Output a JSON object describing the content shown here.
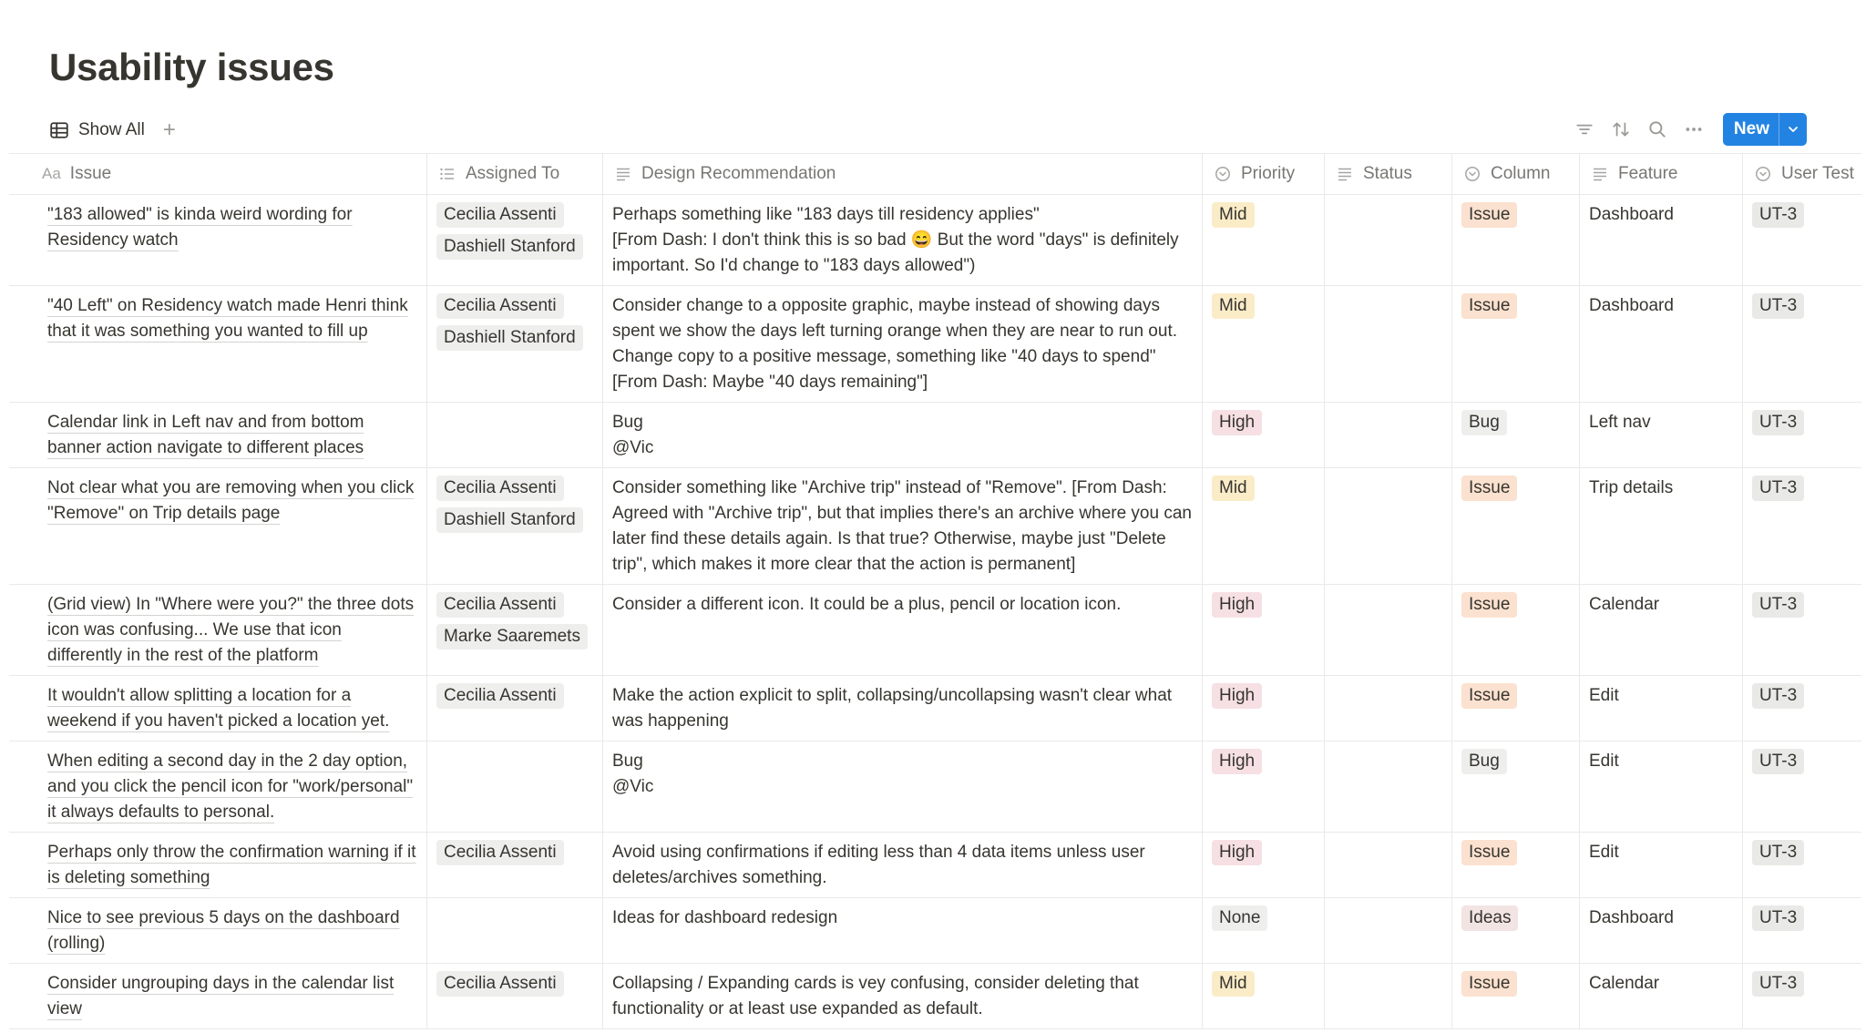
{
  "page": {
    "title": "Usability issues"
  },
  "view": {
    "label": "Show All",
    "add_symbol": "+"
  },
  "toolbar": {
    "new_label": "New"
  },
  "columns": [
    "Issue",
    "Assigned To",
    "Design Recommendation",
    "Priority",
    "Status",
    "Column",
    "Feature",
    "User Test"
  ],
  "column_icons": [
    "text-type-icon",
    "list-icon",
    "lines-icon",
    "select-icon",
    "lines-icon",
    "select-icon",
    "lines-icon",
    "select-icon"
  ],
  "tag_colors": {
    "Mid": "#fbecc8",
    "High": "#f6e0e4",
    "None": "#eeeeec",
    "Issue": "#fbe1cf",
    "Bug": "#eeeeec",
    "Ideas": "#f3e4e4",
    "UT-3": "#e9e9e7"
  },
  "rows": [
    {
      "issue": "\"183 allowed\" is kinda weird wording for Residency watch",
      "assigned": [
        "Cecilia Assenti",
        "Dashiell Stanford"
      ],
      "recommendation": [
        "Perhaps something like \"183 days till residency applies\"",
        "[From Dash: I don't think this is so bad 😄 But the word \"days\" is definitely important. So I'd change to \"183 days allowed\")"
      ],
      "priority": "Mid",
      "status": "",
      "column": "Issue",
      "feature": "Dashboard",
      "user_test": "UT-3"
    },
    {
      "issue": "\"40 Left\" on Residency watch made Henri think that it was something you wanted to fill up",
      "assigned": [
        "Cecilia Assenti",
        "Dashiell Stanford"
      ],
      "recommendation": [
        "Consider change to a opposite graphic, maybe instead of showing days spent we show the days left turning orange when they are near to run out. Change copy to a positive message, something like \"40 days to spend\"",
        "[From Dash: Maybe \"40 days remaining\"]"
      ],
      "priority": "Mid",
      "status": "",
      "column": "Issue",
      "feature": "Dashboard",
      "user_test": "UT-3"
    },
    {
      "issue": "Calendar link in Left nav and from bottom banner action navigate to different places",
      "assigned": [],
      "recommendation": [
        "Bug",
        "@Vic"
      ],
      "priority": "High",
      "status": "",
      "column": "Bug",
      "feature": "Left nav",
      "user_test": "UT-3"
    },
    {
      "issue": "Not clear what you are removing when you click \"Remove\" on Trip details page",
      "assigned": [
        "Cecilia Assenti",
        "Dashiell Stanford"
      ],
      "recommendation": [
        "Consider something like \"Archive trip\" instead of \"Remove\". [From Dash: Agreed with \"Archive trip\", but that implies there's an archive where you can later find these details again. Is that true? Otherwise, maybe just \"Delete trip\", which makes it more clear that the action is permanent]"
      ],
      "priority": "Mid",
      "status": "",
      "column": "Issue",
      "feature": "Trip details",
      "user_test": "UT-3"
    },
    {
      "issue": "(Grid view) In \"Where were you?\" the three dots icon was confusing... We use that icon differently in the rest of the platform",
      "assigned": [
        "Cecilia Assenti",
        "Marke Saaremets"
      ],
      "recommendation": [
        "Consider a different icon. It could be a plus, pencil or location icon."
      ],
      "priority": "High",
      "status": "",
      "column": "Issue",
      "feature": "Calendar",
      "user_test": "UT-3"
    },
    {
      "issue": "It wouldn't allow splitting a location for a weekend if you haven't picked a location yet.",
      "assigned": [
        "Cecilia Assenti"
      ],
      "recommendation": [
        "Make the action explicit to split, collapsing/uncollapsing wasn't clear what was happening"
      ],
      "priority": "High",
      "status": "",
      "column": "Issue",
      "feature": "Edit",
      "user_test": "UT-3"
    },
    {
      "issue": "When editing a second day in the 2 day option, and you click the pencil icon for \"work/personal\" it always defaults to personal.",
      "assigned": [],
      "recommendation": [
        "Bug",
        "@Vic"
      ],
      "priority": "High",
      "status": "",
      "column": "Bug",
      "feature": "Edit",
      "user_test": "UT-3"
    },
    {
      "issue": "Perhaps only throw the confirmation warning if it is deleting something",
      "assigned": [
        "Cecilia Assenti"
      ],
      "recommendation": [
        "Avoid using confirmations if editing less than 4 data items unless user deletes/archives something."
      ],
      "priority": "High",
      "status": "",
      "column": "Issue",
      "feature": "Edit",
      "user_test": "UT-3"
    },
    {
      "issue": "Nice to see previous 5 days on the dashboard (rolling)",
      "assigned": [],
      "recommendation": [
        "Ideas for dashboard redesign"
      ],
      "priority": "None",
      "status": "",
      "column": "Ideas",
      "feature": "Dashboard",
      "user_test": "UT-3"
    },
    {
      "issue": "Consider ungrouping days in the calendar list view",
      "assigned": [
        "Cecilia Assenti"
      ],
      "recommendation": [
        "Collapsing / Expanding cards is vey confusing, consider deleting that functionality or at least use expanded as default."
      ],
      "priority": "Mid",
      "status": "",
      "column": "Issue",
      "feature": "Calendar",
      "user_test": "UT-3"
    }
  ]
}
